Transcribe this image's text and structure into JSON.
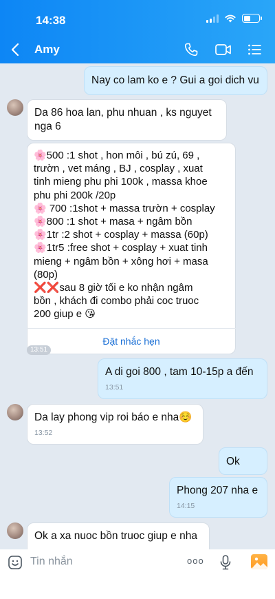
{
  "status_bar": {
    "time": "14:38"
  },
  "header": {
    "contact_name": "Amy",
    "icons": [
      "back-icon",
      "phone-icon",
      "video-call-icon",
      "list-menu-icon"
    ]
  },
  "messages": [
    {
      "direction": "out",
      "text": "Nay co lam ko e ? Gui a goi dich vu"
    },
    {
      "direction": "in",
      "lines": [
        "Da 86 hoa lan, phu nhuan , ks nguyet",
        "nga 6"
      ]
    },
    {
      "direction": "in",
      "lines": [
        "🌸500 :1 shot , hon môi , bú zú, 69 ,",
        "trườn , vet máng , BJ , cosplay , xuat",
        "tinh mieng phu phi 100k , massa khoe",
        "phu phi 200k /20p",
        "🌸 700 :1shot + massa trườn + cosplay",
        "🌸800 :1 shot + masa + ngâm bồn",
        "🌸1tr :2 shot + cosplay + massa (60p)",
        "🌸1tr5 :free shot + cosplay + xuat tinh",
        "mieng + ngâm bồn + xông hơi + masa",
        "(80p)",
        "❌❌sau 8 giờ tối e ko nhận ngâm",
        "bồn , khách đi combo phải coc truoc",
        "200 giup e 😘"
      ],
      "action": "Đặt nhắc hẹn"
    },
    {
      "type": "time_pill",
      "text": "13:51"
    },
    {
      "direction": "out",
      "text": "A di goi 800 , tam 10-15p a đến",
      "time": "13:51"
    },
    {
      "direction": "in",
      "text": "Da lay phong vip roi báo e nha☺️",
      "time": "13:52"
    },
    {
      "direction": "out",
      "text": "Ok"
    },
    {
      "direction": "out",
      "text": "Phong 207 nha e",
      "time": "14:15"
    },
    {
      "direction": "in",
      "text": "Ok a xa nuoc bồn truoc giup e nha"
    }
  ],
  "composer": {
    "placeholder": "Tin nhắn",
    "more_label": "ooo",
    "icons": [
      "emoji-icon",
      "more-icon",
      "microphone-icon",
      "image-icon"
    ]
  },
  "colors": {
    "header_gradient_start": "#0d86f5",
    "header_gradient_end": "#2aa6f8",
    "chat_background": "#e2e9f1",
    "outgoing_bubble": "#d6efff",
    "incoming_bubble": "#ffffff",
    "link": "#1a6fd6"
  }
}
